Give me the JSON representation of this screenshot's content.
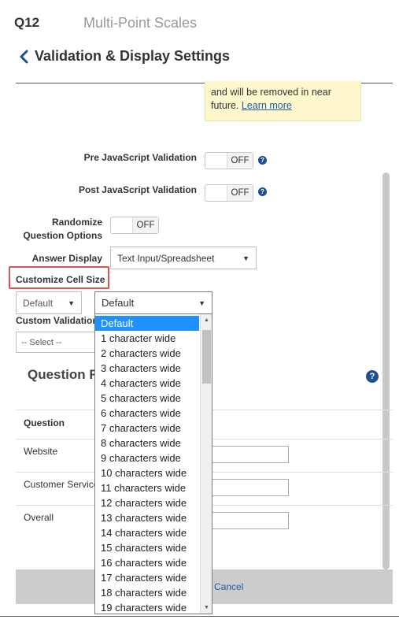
{
  "header": {
    "question_number": "Q12",
    "question_type": "Multi-Point Scales",
    "page_title": "Validation & Display Settings"
  },
  "notice": {
    "text": "and will be removed in near future.",
    "link_label": "Learn more"
  },
  "settings": {
    "pre_js_label": "Pre JavaScript Validation",
    "pre_js_toggle": "OFF",
    "post_js_label": "Post JavaScript Validation",
    "post_js_toggle": "OFF",
    "randomize_label_line1": "Randomize",
    "randomize_label_line2": "Question Options",
    "randomize_toggle": "OFF",
    "answer_display_label": "Answer Display",
    "answer_display_value": "Text Input/Spreadsheet",
    "customize_cell_size_label": "Customize Cell Size",
    "cell_size_left_value": "Default",
    "cell_size_right_value": "Default",
    "custom_validation_label": "Custom Validation",
    "custom_validation_value": "-- Select --"
  },
  "question_section": {
    "title": "Question R",
    "column_header": "Question",
    "rows": [
      "Website",
      "Customer Service",
      "Overall"
    ]
  },
  "footer": {
    "cancel_label": "Cancel"
  },
  "dropdown": {
    "options": [
      "Default",
      "1 character wide",
      "2 characters wide",
      "3 characters wide",
      "4 characters wide",
      "5 characters wide",
      "6 characters wide",
      "7 characters wide",
      "8 characters wide",
      "9 characters wide",
      "10 characters wide",
      "11 characters wide",
      "12 characters wide",
      "13 characters wide",
      "14 characters wide",
      "15 characters wide",
      "16 characters wide",
      "17 characters wide",
      "18 characters wide",
      "19 characters wide"
    ],
    "selected": "Default"
  },
  "colors": {
    "accent_blue": "#1d4f9a",
    "highlight_red": "#d9534f",
    "selection_blue": "#1e90ff",
    "notice_bg": "#fff8cf"
  }
}
